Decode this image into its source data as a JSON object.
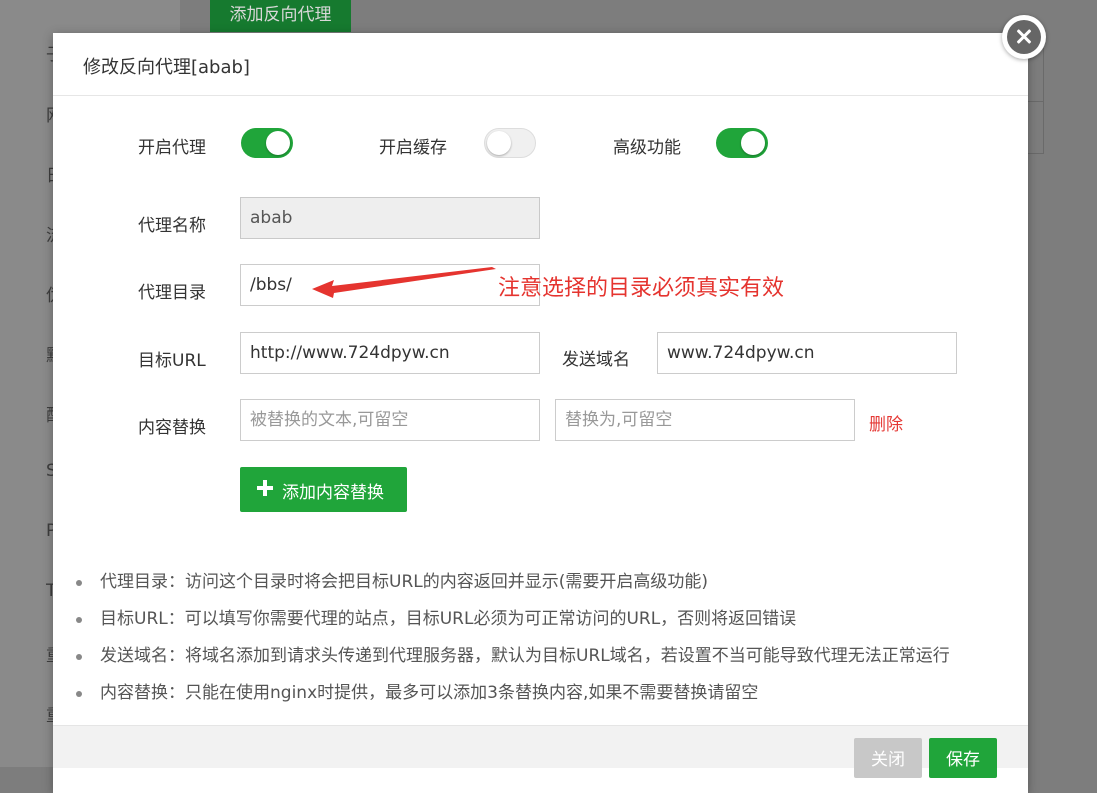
{
  "background": {
    "add_button": "添加反向代理",
    "sidebar_glyphs": [
      "子",
      "网",
      "日",
      "流",
      "伪",
      "默",
      "配",
      "S",
      "P",
      "T",
      "重",
      "重"
    ]
  },
  "modal": {
    "title": "修改反向代理[abab]",
    "toggles": [
      {
        "label": "开启代理",
        "on": true
      },
      {
        "label": "开启缓存",
        "on": false
      },
      {
        "label": "高级功能",
        "on": true
      }
    ],
    "proxy_name": {
      "label": "代理名称",
      "value": "abab"
    },
    "proxy_dir": {
      "label": "代理目录",
      "value": "/bbs/"
    },
    "annotation": "注意选择的目录必须真实有效",
    "target_url": {
      "label": "目标URL",
      "value": "http://www.724dpyw.cn"
    },
    "send_domain": {
      "label": "发送域名",
      "value": "www.724dpyw.cn"
    },
    "replace": {
      "label": "内容替换",
      "from_placeholder": "被替换的文本,可留空",
      "to_placeholder": "替换为,可留空",
      "delete_label": "删除"
    },
    "add_replace_button": "添加内容替换",
    "tips": [
      "代理目录：访问这个目录时将会把目标URL的内容返回并显示(需要开启高级功能)",
      "目标URL：可以填写你需要代理的站点，目标URL必须为可正常访问的URL，否则将返回错误",
      "发送域名：将域名添加到请求头传递到代理服务器，默认为目标URL域名，若设置不当可能导致代理无法正常运行",
      "内容替换：只能在使用nginx时提供，最多可以添加3条替换内容,如果不需要替换请留空"
    ],
    "footer": {
      "close_label": "关闭",
      "save_label": "保存"
    }
  },
  "colors": {
    "accent": "#20a53a",
    "danger": "#e53935",
    "annotation": "#e5342f"
  }
}
